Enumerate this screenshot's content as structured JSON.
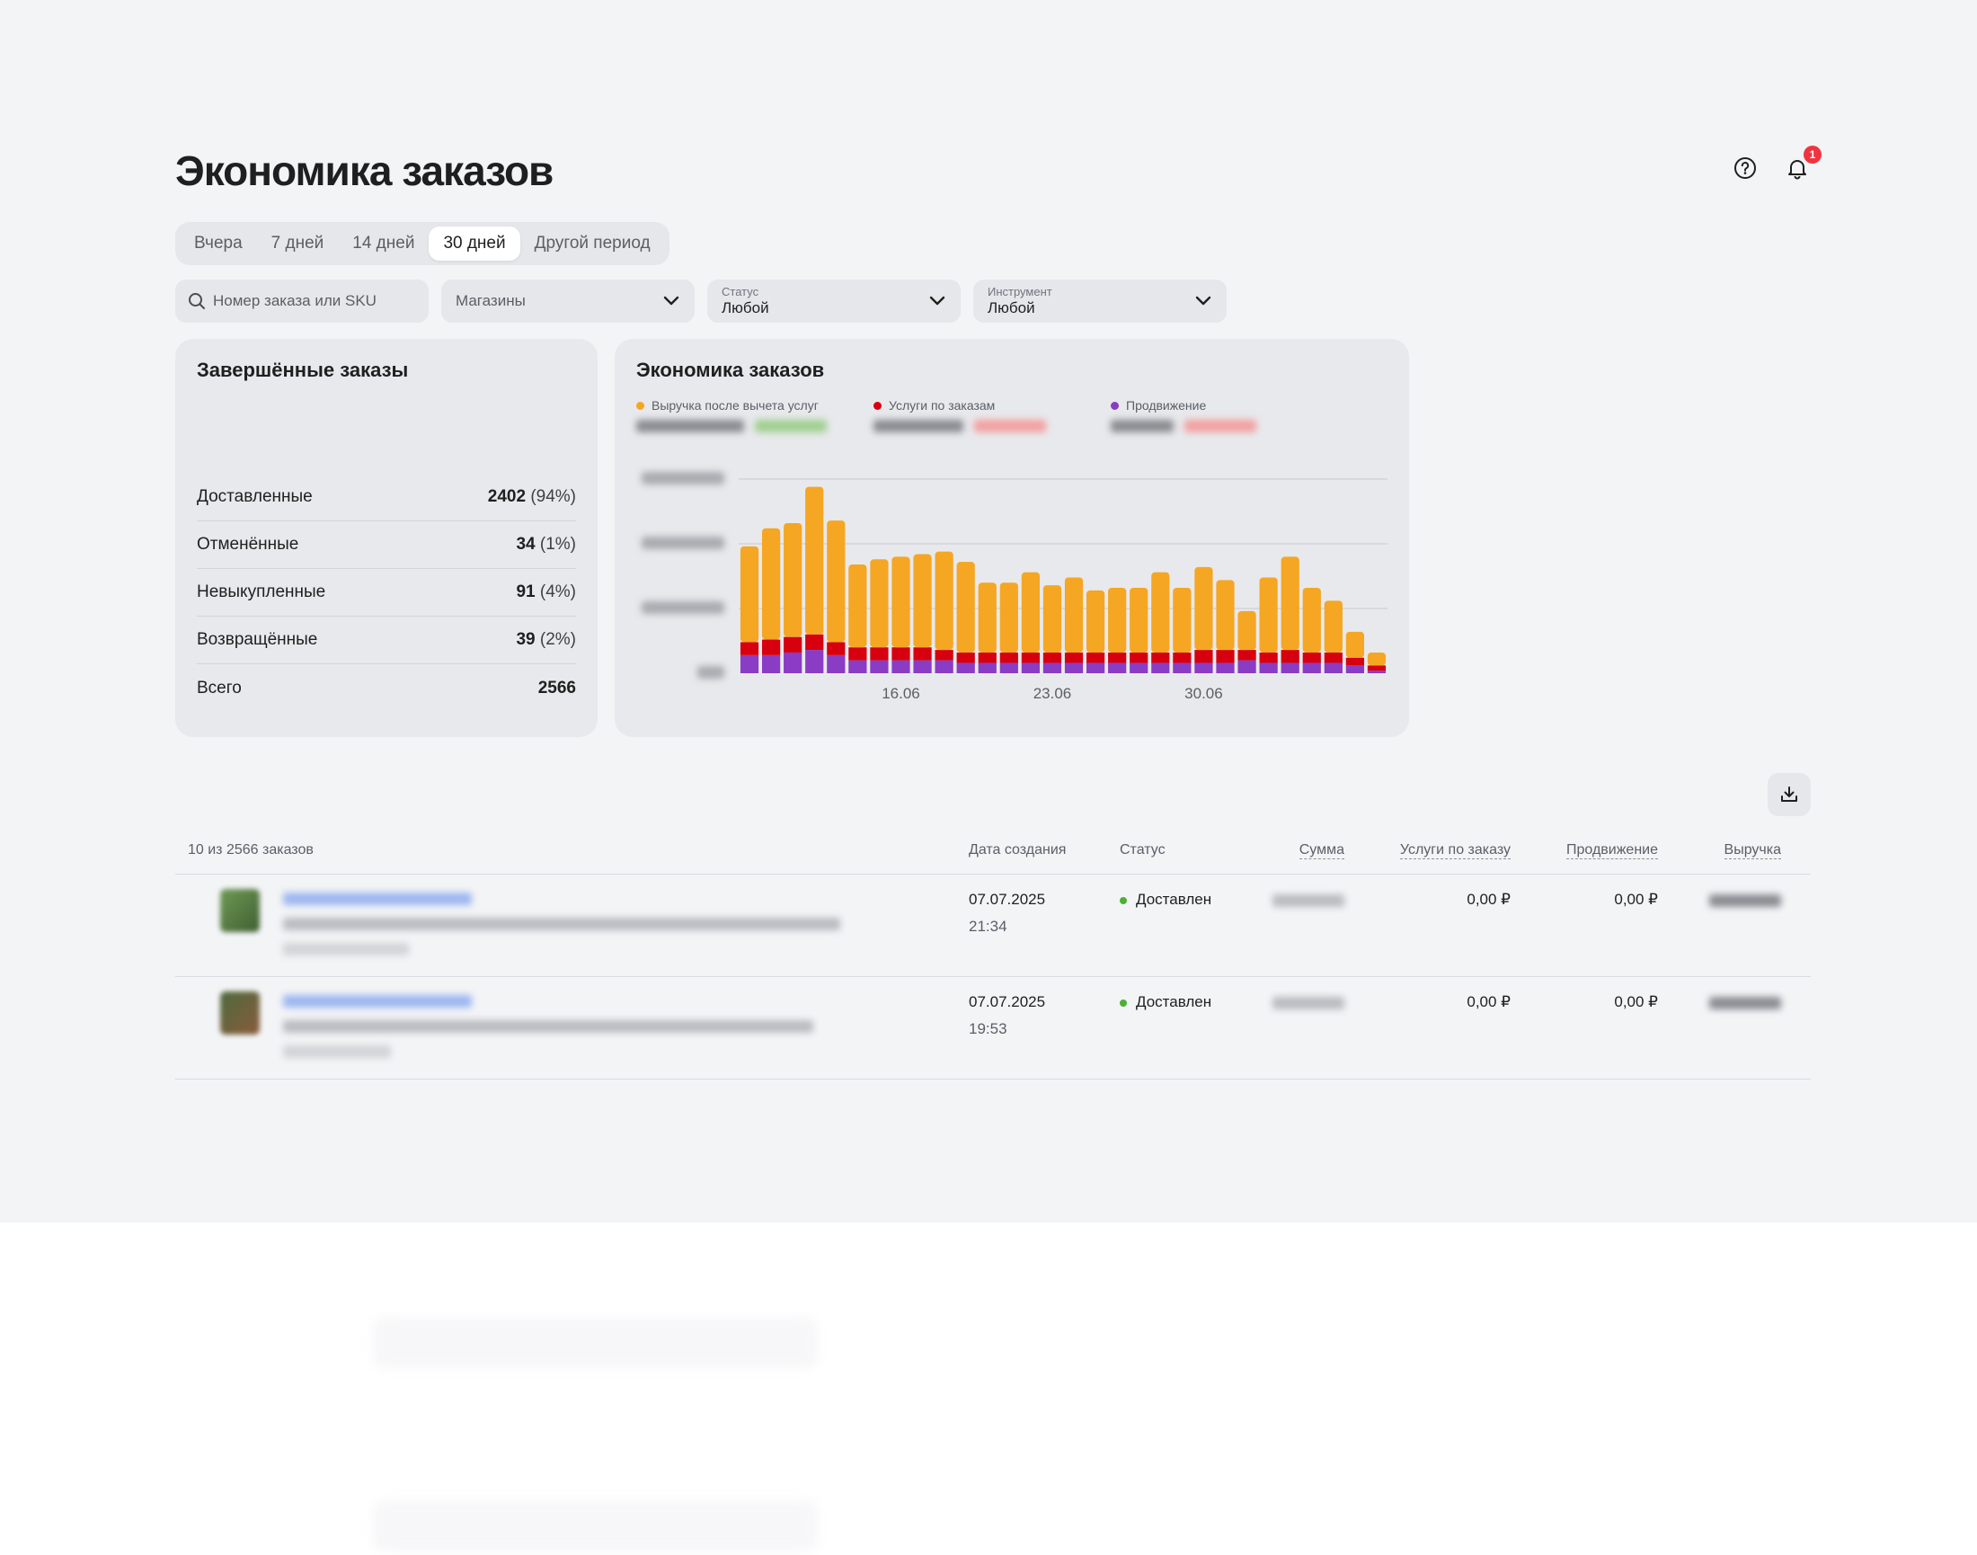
{
  "page": {
    "title": "Экономика заказов",
    "notification_count": "1"
  },
  "header_icons": {
    "help": "question-circle-icon",
    "notifications": "bell-icon"
  },
  "period_tabs": [
    {
      "label": "Вчера",
      "active": false
    },
    {
      "label": "7 дней",
      "active": false
    },
    {
      "label": "14 дней",
      "active": false
    },
    {
      "label": "30 дней",
      "active": true
    },
    {
      "label": "Другой период",
      "active": false
    }
  ],
  "filters": {
    "search_placeholder": "Номер заказа или SKU",
    "shops_placeholder": "Магазины",
    "status_caption": "Статус",
    "status_value": "Любой",
    "instrument_caption": "Инструмент",
    "instrument_value": "Любой"
  },
  "completed_orders": {
    "title": "Завершённые заказы",
    "rows": [
      {
        "label": "Доставленные",
        "value": "2402",
        "pct": "(94%)"
      },
      {
        "label": "Отменённые",
        "value": "34",
        "pct": "(1%)"
      },
      {
        "label": "Невыкупленные",
        "value": "91",
        "pct": "(4%)"
      },
      {
        "label": "Возвращённые",
        "value": "39",
        "pct": "(2%)"
      },
      {
        "label": "Всего",
        "value": "2566",
        "pct": ""
      }
    ]
  },
  "colors": {
    "revenue": "#f5a623",
    "services": "#d7000f",
    "promotion": "#8a3cc4",
    "status_delivered": "#4caf36"
  },
  "chart_card": {
    "title": "Экономика заказов"
  },
  "chart_data": {
    "type": "bar",
    "stacked": true,
    "categories": [
      "09.06",
      "10.06",
      "11.06",
      "12.06",
      "13.06",
      "14.06",
      "15.06",
      "16.06",
      "17.06",
      "18.06",
      "19.06",
      "20.06",
      "21.06",
      "22.06",
      "23.06",
      "24.06",
      "25.06",
      "26.06",
      "27.06",
      "28.06",
      "29.06",
      "30.06",
      "01.07",
      "02.07",
      "03.07",
      "04.07",
      "05.07",
      "06.07",
      "07.07",
      "08.07"
    ],
    "x_ticks": [
      "16.06",
      "23.06",
      "30.06"
    ],
    "series": [
      {
        "name": "Продвижение",
        "color": "#8a3cc4",
        "values": [
          0.07,
          0.07,
          0.08,
          0.09,
          0.07,
          0.05,
          0.05,
          0.05,
          0.05,
          0.05,
          0.04,
          0.04,
          0.04,
          0.04,
          0.04,
          0.04,
          0.04,
          0.04,
          0.04,
          0.04,
          0.04,
          0.04,
          0.04,
          0.05,
          0.04,
          0.04,
          0.04,
          0.04,
          0.03,
          0.01
        ]
      },
      {
        "name": "Услуги по заказам",
        "color": "#d7000f",
        "values": [
          0.05,
          0.06,
          0.06,
          0.06,
          0.05,
          0.05,
          0.05,
          0.05,
          0.05,
          0.04,
          0.04,
          0.04,
          0.04,
          0.04,
          0.04,
          0.04,
          0.04,
          0.04,
          0.04,
          0.04,
          0.04,
          0.05,
          0.05,
          0.04,
          0.04,
          0.05,
          0.04,
          0.04,
          0.03,
          0.02
        ]
      },
      {
        "name": "Выручка после вычета услуг",
        "color": "#f5a623",
        "values": [
          0.37,
          0.43,
          0.44,
          0.57,
          0.47,
          0.32,
          0.34,
          0.35,
          0.36,
          0.38,
          0.35,
          0.27,
          0.27,
          0.31,
          0.26,
          0.29,
          0.24,
          0.25,
          0.25,
          0.31,
          0.25,
          0.32,
          0.27,
          0.15,
          0.29,
          0.36,
          0.25,
          0.2,
          0.1,
          0.05
        ]
      }
    ],
    "ylim": [
      0,
      0.75
    ],
    "grid": true
  },
  "download": {
    "icon": "download-icon"
  },
  "table": {
    "count_label": "10 из 2566 заказов",
    "headers": {
      "date": "Дата создания",
      "status": "Статус",
      "sum": "Сумма",
      "services": "Услуги по заказу",
      "promotion": "Продвижение",
      "revenue": "Выручка"
    },
    "rows": [
      {
        "date": "07.07.2025",
        "time": "21:34",
        "status": "Доставлен",
        "services": "0,00 ₽",
        "promotion": "0,00 ₽"
      },
      {
        "date": "07.07.2025",
        "time": "19:53",
        "status": "Доставлен",
        "services": "0,00 ₽",
        "promotion": "0,00 ₽"
      }
    ]
  }
}
